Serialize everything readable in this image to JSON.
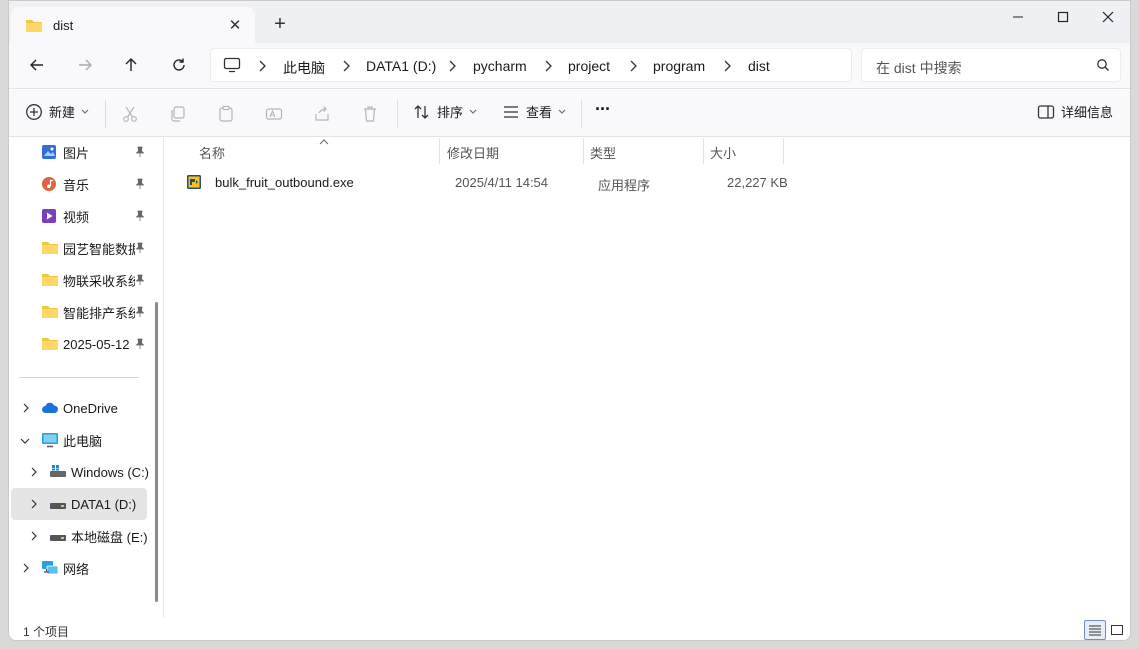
{
  "tab": {
    "title": "dist",
    "close": "✕",
    "new": "+"
  },
  "window_controls": {
    "minimize": "—",
    "maximize": "☐",
    "close": "✕"
  },
  "nav": {
    "breadcrumbs": [
      "此电脑",
      "DATA1 (D:)",
      "pycharm",
      "project",
      "program",
      "dist"
    ],
    "search_placeholder": "在 dist 中搜索"
  },
  "toolbar": {
    "new_label": "新建",
    "sort_label": "排序",
    "view_label": "查看",
    "more_label": "···",
    "details_label": "详细信息"
  },
  "sidebar": {
    "pinned": [
      {
        "label": "图片",
        "icon": "pictures-icon",
        "color": "#2f6fd6"
      },
      {
        "label": "音乐",
        "icon": "music-icon",
        "color": "#e0643c"
      },
      {
        "label": "视频",
        "icon": "videos-icon",
        "color": "#7b3fb8"
      },
      {
        "label": "园艺智能数据",
        "icon": "folder-icon",
        "color": "#f4c542"
      },
      {
        "label": "物联采收系统",
        "icon": "folder-icon",
        "color": "#f4c542"
      },
      {
        "label": "智能排产系统",
        "icon": "folder-icon",
        "color": "#f4c542"
      },
      {
        "label": "2025-05-12",
        "icon": "folder-icon",
        "color": "#f4c542"
      }
    ],
    "tree": [
      {
        "label": "OneDrive",
        "icon": "cloud-icon",
        "expanded": false
      },
      {
        "label": "此电脑",
        "icon": "computer-icon",
        "expanded": true
      },
      {
        "label": "Windows (C:)",
        "icon": "windows-drive-icon",
        "expanded": false
      },
      {
        "label": "DATA1 (D:)",
        "icon": "drive-icon",
        "expanded": false,
        "selected": true
      },
      {
        "label": "本地磁盘 (E:)",
        "icon": "drive-icon",
        "expanded": false
      },
      {
        "label": "网络",
        "icon": "network-icon",
        "expanded": false
      }
    ]
  },
  "columns": {
    "name": "名称",
    "modified": "修改日期",
    "type": "类型",
    "size": "大小"
  },
  "files": [
    {
      "name": "bulk_fruit_outbound.exe",
      "modified": "2025/4/11 14:54",
      "type": "应用程序",
      "size": "22,227 KB",
      "icon": "exe-icon"
    }
  ],
  "status": {
    "count": "1 个项目"
  }
}
